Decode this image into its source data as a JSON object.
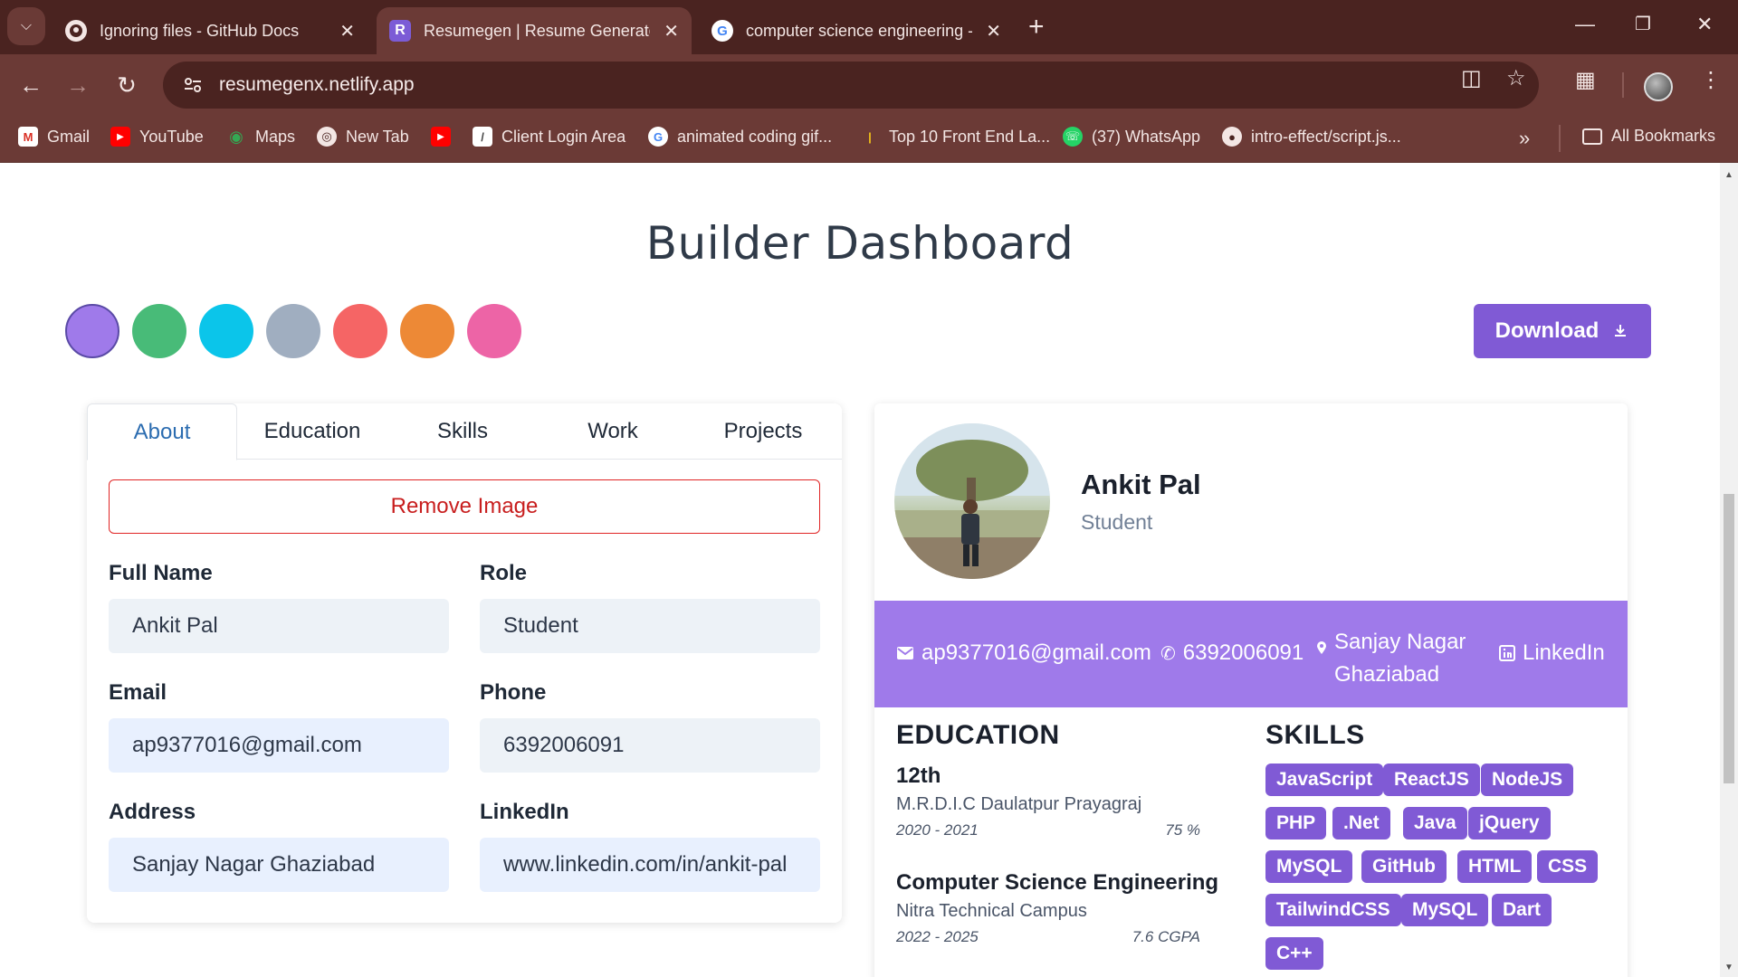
{
  "browser": {
    "tabs": [
      {
        "title": "Ignoring files - GitHub Docs",
        "icon": "github-icon"
      },
      {
        "title": "Resumegen | Resume Generator",
        "icon": "resumegen-r-icon"
      },
      {
        "title": "computer science engineering - Google Search",
        "icon": "google-icon"
      }
    ],
    "url": "resumegenx.netlify.app",
    "bookmarks": [
      {
        "label": "Gmail",
        "icon": "gmail-icon"
      },
      {
        "label": "YouTube",
        "icon": "youtube-icon"
      },
      {
        "label": "Maps",
        "icon": "maps-icon"
      },
      {
        "label": "New Tab",
        "icon": "globe-icon"
      },
      {
        "label": "",
        "icon": "youtube-icon"
      },
      {
        "label": "Client Login Area",
        "icon": "site-icon"
      },
      {
        "label": "animated coding gif...",
        "icon": "google-icon"
      },
      {
        "label": "Top 10 Front End La...",
        "icon": "site-icon"
      },
      {
        "label": "(37) WhatsApp",
        "icon": "whatsapp-icon"
      },
      {
        "label": "intro-effect/script.js...",
        "icon": "github-icon"
      }
    ],
    "all_bookmarks": "All Bookmarks"
  },
  "page": {
    "title": "Builder Dashboard",
    "download_label": "Download",
    "colors": {
      "purple": "#9f7aea",
      "green": "#48bb78",
      "cyan": "#0bc5ea",
      "gray": "#a0aec0",
      "red": "#f56565",
      "orange": "#ed8936",
      "pink": "#ed64a6",
      "accent": "#805ad5",
      "theme_bar": "#9f7aea"
    }
  },
  "form": {
    "tabs": [
      "About",
      "Education",
      "Skills",
      "Work",
      "Projects"
    ],
    "active_tab": "About",
    "remove_image_label": "Remove Image",
    "fields": {
      "full_name": {
        "label": "Full Name",
        "value": "Ankit Pal"
      },
      "role": {
        "label": "Role",
        "value": "Student"
      },
      "email": {
        "label": "Email",
        "value": "ap9377016@gmail.com"
      },
      "phone": {
        "label": "Phone",
        "value": "6392006091"
      },
      "address": {
        "label": "Address",
        "value": "Sanjay Nagar Ghaziabad"
      },
      "linkedin": {
        "label": "LinkedIn",
        "value": "www.linkedin.com/in/ankit-pal"
      }
    }
  },
  "resume": {
    "name": "Ankit Pal",
    "role": "Student",
    "contact": {
      "email": "ap9377016@gmail.com",
      "phone": "6392006091",
      "address_line1": "Sanjay Nagar",
      "address_line2": "Ghaziabad",
      "linkedin": "LinkedIn"
    },
    "education_heading": "EDUCATION",
    "skills_heading": "SKILLS",
    "education": [
      {
        "degree": "12th",
        "school": "M.R.D.I.C Daulatpur Prayagraj",
        "years": "2020 - 2021",
        "grade": "75 %"
      },
      {
        "degree": "Computer Science Engineering",
        "school": "Nitra Technical Campus",
        "years": "2022 - 2025",
        "grade": "7.6 CGPA"
      }
    ],
    "skills": [
      "JavaScript",
      "ReactJS",
      "NodeJS",
      "PHP",
      ".Net",
      "Java",
      "jQuery",
      "MySQL",
      "GitHub",
      "HTML",
      "CSS",
      "TailwindCSS",
      "MySQL",
      "Dart",
      "C++"
    ]
  }
}
